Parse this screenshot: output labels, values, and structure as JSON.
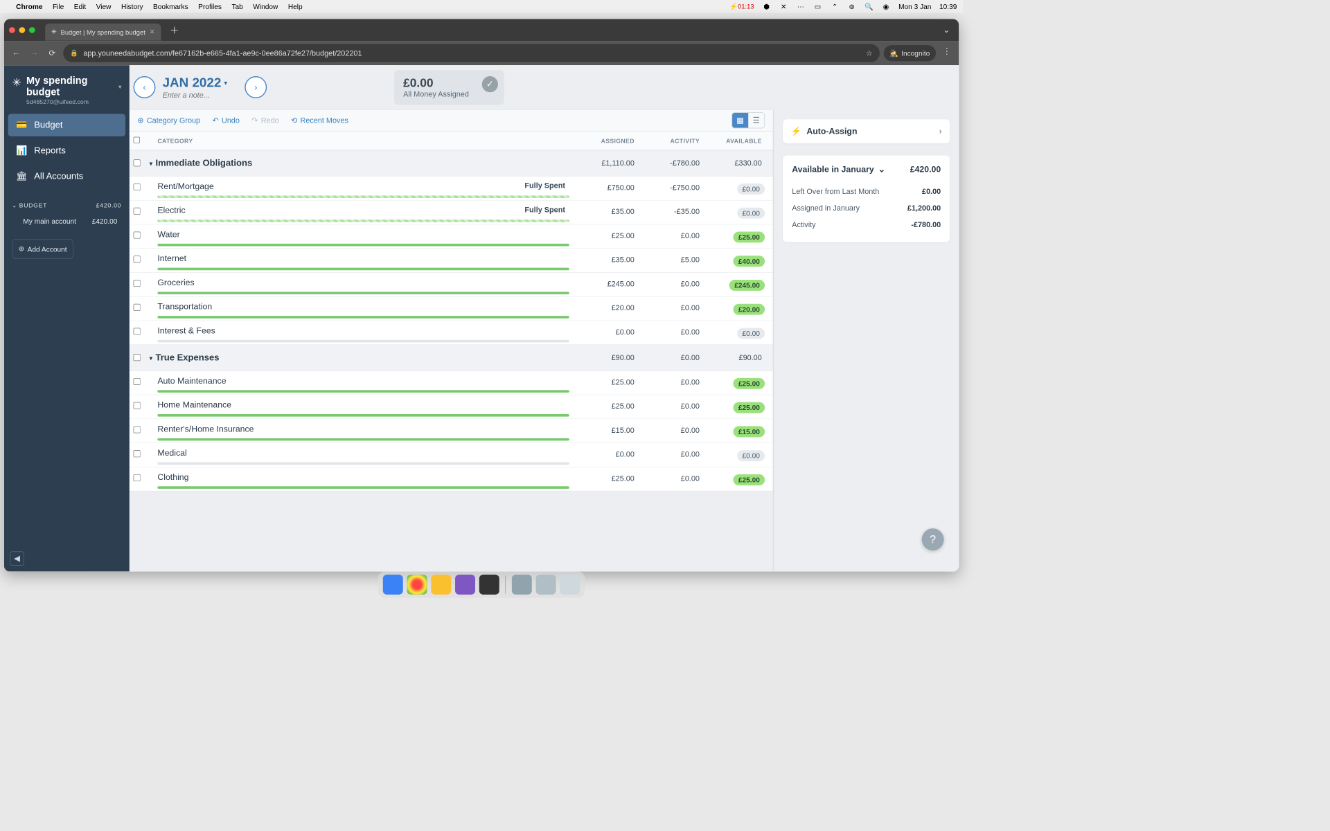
{
  "menubar": {
    "app": "Chrome",
    "items": [
      "File",
      "Edit",
      "View",
      "History",
      "Bookmarks",
      "Profiles",
      "Tab",
      "Window",
      "Help"
    ],
    "battery_time": "01:13",
    "date": "Mon 3 Jan",
    "time": "10:39"
  },
  "browser": {
    "tab_title": "Budget | My spending budget",
    "url": "app.youneedabudget.com/fe67162b-e665-4fa1-ae9c-0ee86a72fe27/budget/202201",
    "incognito": "Incognito"
  },
  "sidebar": {
    "budget_name": "My spending budget",
    "email": "5d485270@uifeed.com",
    "nav": [
      {
        "icon": "💳",
        "label": "Budget"
      },
      {
        "icon": "📊",
        "label": "Reports"
      },
      {
        "icon": "🏛",
        "label": "All Accounts"
      }
    ],
    "budget_label": "BUDGET",
    "budget_total": "£420.00",
    "account_name": "My main account",
    "account_balance": "£420.00",
    "add_account": "Add Account"
  },
  "header": {
    "month": "JAN 2022",
    "note_placeholder": "Enter a note...",
    "money": "£0.00",
    "money_label": "All Money Assigned"
  },
  "toolbar": {
    "category_group": "Category Group",
    "undo": "Undo",
    "redo": "Redo",
    "recent": "Recent Moves"
  },
  "columns": {
    "category": "CATEGORY",
    "assigned": "ASSIGNED",
    "activity": "ACTIVITY",
    "available": "AVAILABLE"
  },
  "groups": [
    {
      "name": "Immediate Obligations",
      "assigned": "£1,110.00",
      "activity": "-£780.00",
      "available": "£330.00",
      "rows": [
        {
          "name": "Rent/Mortgage",
          "status": "Fully Spent",
          "bar": "striped",
          "assigned": "£750.00",
          "activity": "-£750.00",
          "available": "£0.00",
          "pill": "gray"
        },
        {
          "name": "Electric",
          "status": "Fully Spent",
          "bar": "striped",
          "assigned": "£35.00",
          "activity": "-£35.00",
          "available": "£0.00",
          "pill": "gray"
        },
        {
          "name": "Water",
          "status": "",
          "bar": "green",
          "assigned": "£25.00",
          "activity": "£0.00",
          "available": "£25.00",
          "pill": "green"
        },
        {
          "name": "Internet",
          "status": "",
          "bar": "green",
          "assigned": "£35.00",
          "activity": "£5.00",
          "available": "£40.00",
          "pill": "green"
        },
        {
          "name": "Groceries",
          "status": "",
          "bar": "green",
          "assigned": "£245.00",
          "activity": "£0.00",
          "available": "£245.00",
          "pill": "green"
        },
        {
          "name": "Transportation",
          "status": "",
          "bar": "green",
          "assigned": "£20.00",
          "activity": "£0.00",
          "available": "£20.00",
          "pill": "green"
        },
        {
          "name": "Interest & Fees",
          "status": "",
          "bar": "gray",
          "assigned": "£0.00",
          "activity": "£0.00",
          "available": "£0.00",
          "pill": "gray"
        }
      ]
    },
    {
      "name": "True Expenses",
      "assigned": "£90.00",
      "activity": "£0.00",
      "available": "£90.00",
      "rows": [
        {
          "name": "Auto Maintenance",
          "status": "",
          "bar": "green",
          "assigned": "£25.00",
          "activity": "£0.00",
          "available": "£25.00",
          "pill": "green"
        },
        {
          "name": "Home Maintenance",
          "status": "",
          "bar": "green",
          "assigned": "£25.00",
          "activity": "£0.00",
          "available": "£25.00",
          "pill": "green"
        },
        {
          "name": "Renter's/Home Insurance",
          "status": "",
          "bar": "green",
          "assigned": "£15.00",
          "activity": "£0.00",
          "available": "£15.00",
          "pill": "green"
        },
        {
          "name": "Medical",
          "status": "",
          "bar": "gray",
          "assigned": "£0.00",
          "activity": "£0.00",
          "available": "£0.00",
          "pill": "gray"
        },
        {
          "name": "Clothing",
          "status": "",
          "bar": "green",
          "assigned": "£25.00",
          "activity": "£0.00",
          "available": "£25.00",
          "pill": "green"
        }
      ]
    }
  ],
  "inspector": {
    "auto_assign": "Auto-Assign",
    "available_title": "Available in January",
    "available_amount": "£420.00",
    "rows": [
      {
        "label": "Left Over from Last Month",
        "value": "£0.00"
      },
      {
        "label": "Assigned in January",
        "value": "£1,200.00"
      },
      {
        "label": "Activity",
        "value": "-£780.00"
      }
    ]
  }
}
